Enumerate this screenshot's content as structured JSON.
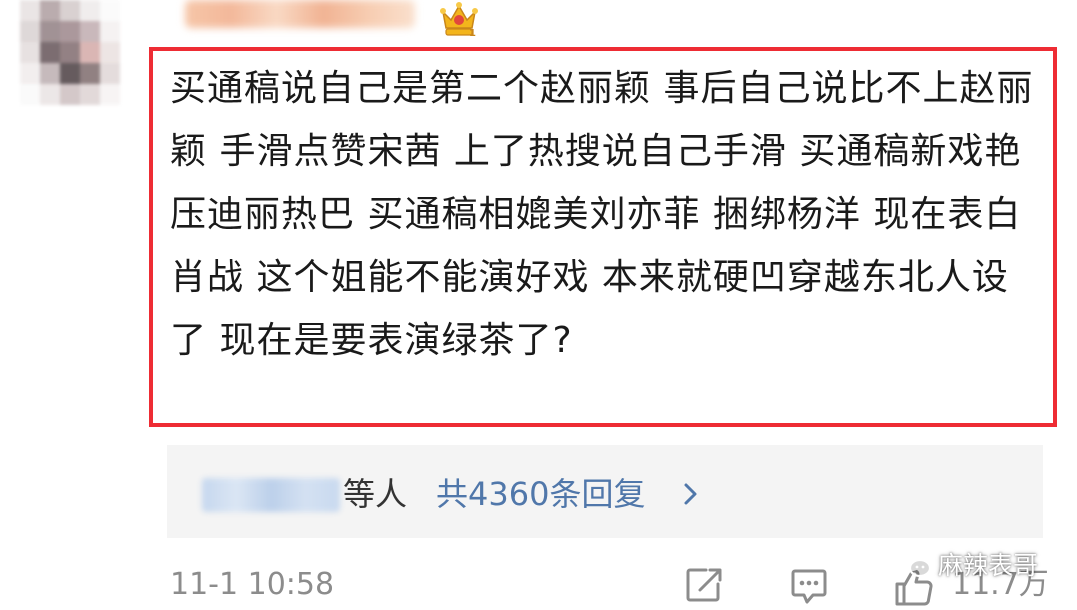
{
  "comment": {
    "text": "买通稿说自己是第二个赵丽颖 事后自己说比不上赵丽颖 手滑点赞宋茜 上了热搜说自己手滑 买通稿新戏艳压迪丽热巴 买通稿相媲美刘亦菲 捆绑杨洋 现在表白肖战 这个姐能不能演好戏 本来就硬凹穿越东北人设了 现在是要表演绿茶了?",
    "highlight_color": "#ee2c34"
  },
  "replies": {
    "and_others": "等人",
    "count_label": "共4360条回复",
    "link_color": "#5077aa",
    "chevron_icon": "chevron-right-icon"
  },
  "footer": {
    "timestamp": "11-1 10:58",
    "share_icon": "share-icon",
    "comment_icon": "comment-icon",
    "like_icon": "thumbs-up-icon",
    "like_count": "11.7万"
  },
  "watermark": {
    "text": "麻辣表哥",
    "icon": "wechat-icon"
  },
  "badge": {
    "icon": "crown-icon"
  }
}
